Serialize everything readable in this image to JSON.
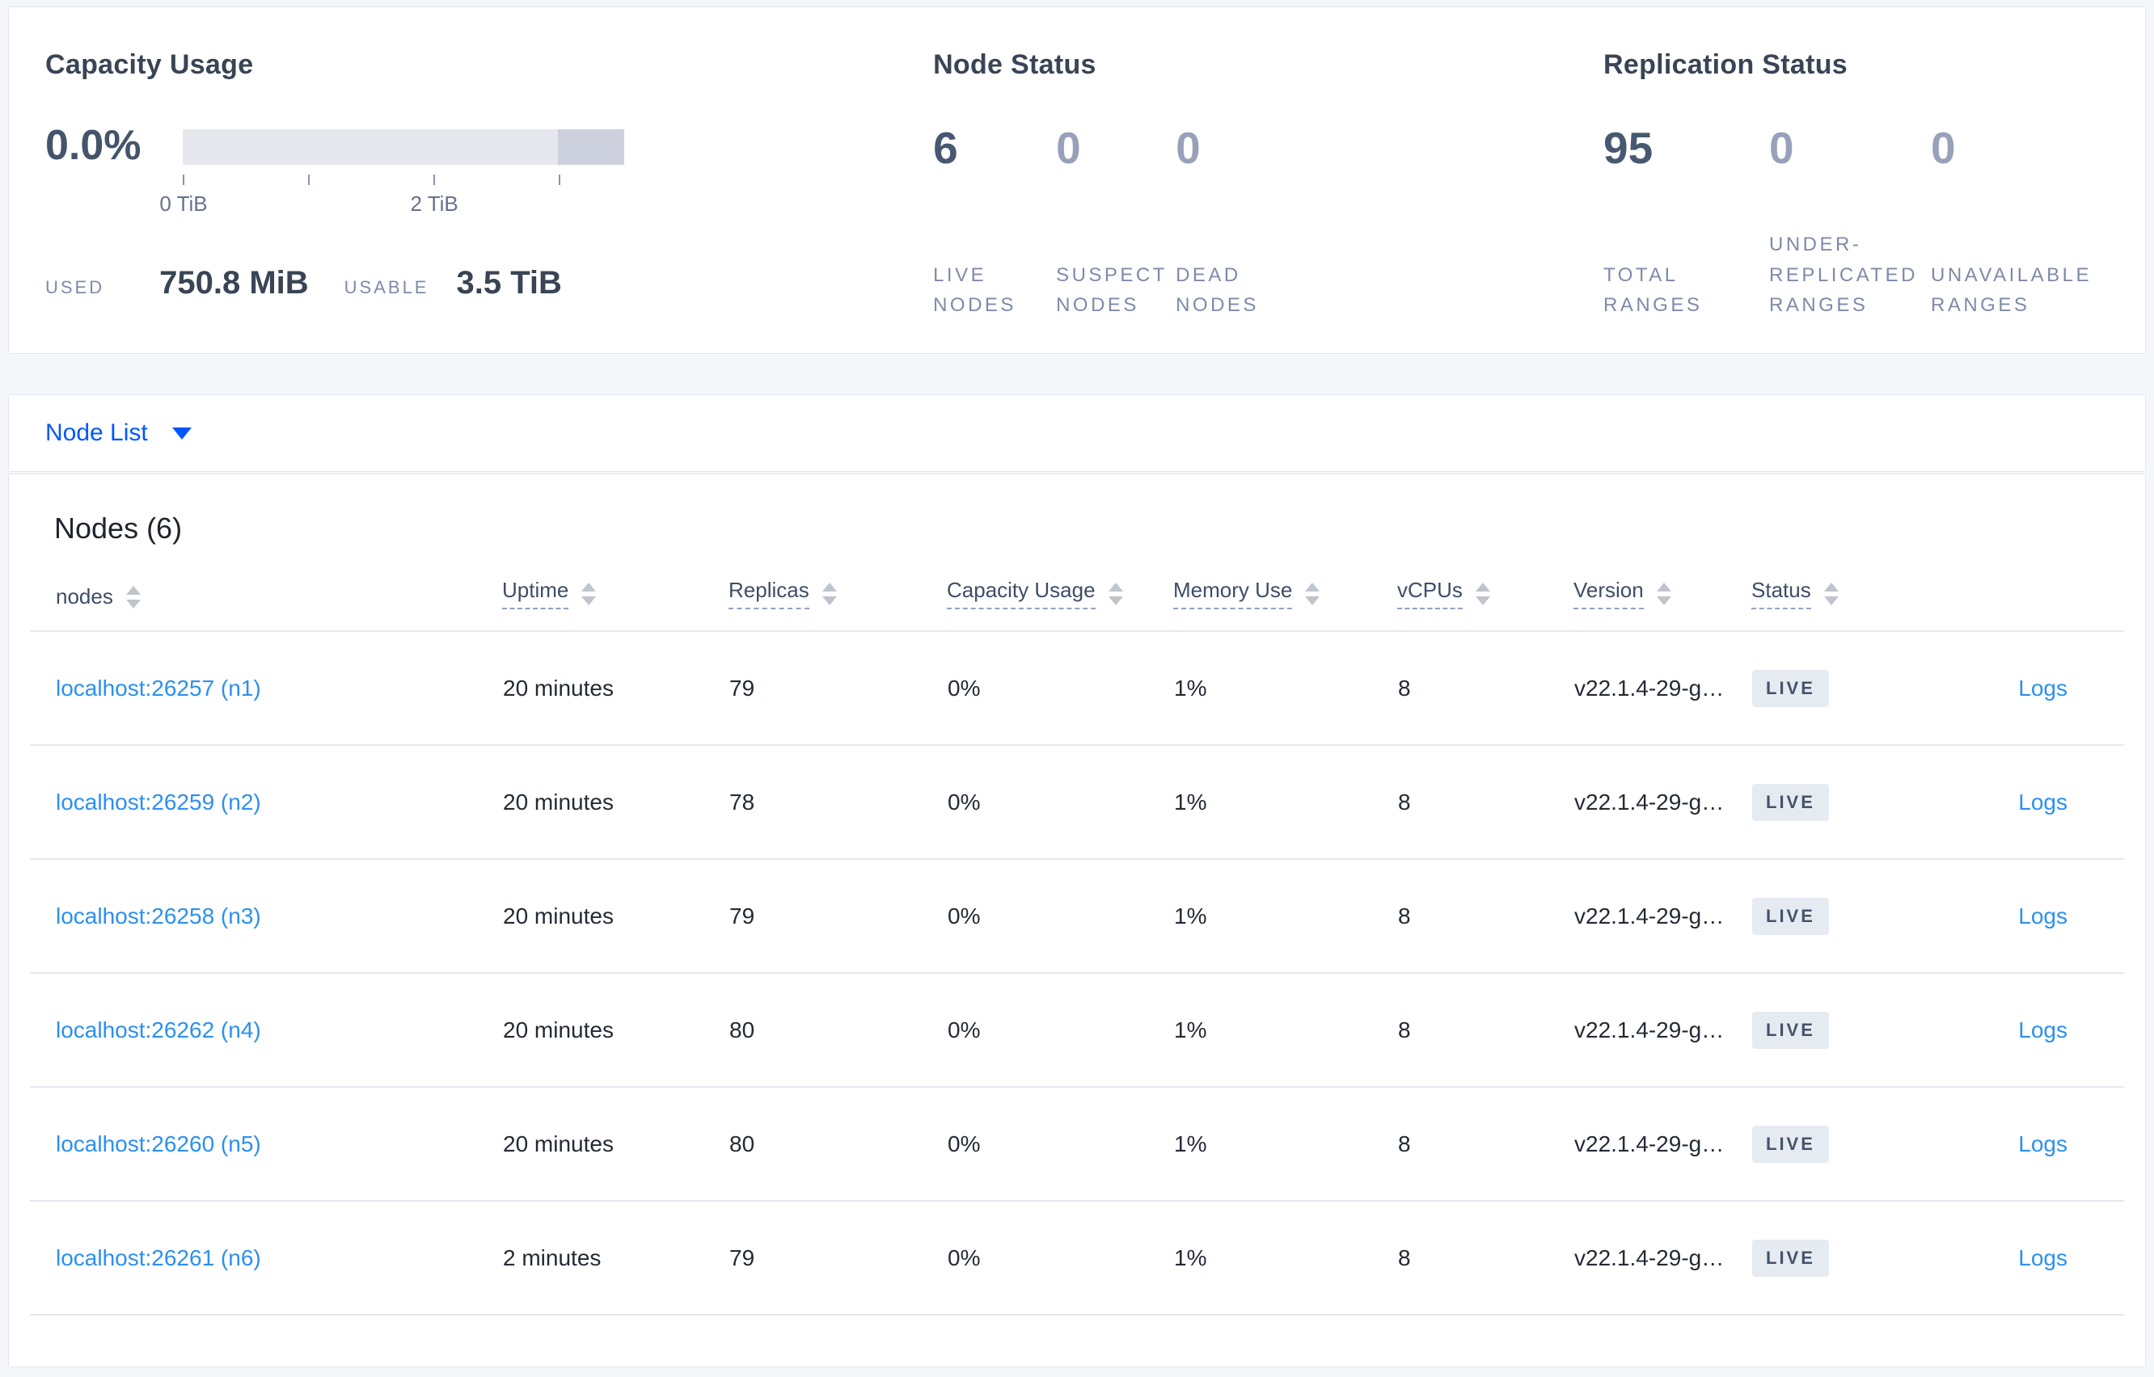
{
  "summary": {
    "capacity": {
      "title": "Capacity Usage",
      "percent": "0.0%",
      "axis_ticks": [
        "0 TiB",
        "2 TiB"
      ],
      "used_label": "USED",
      "used_value": "750.8 MiB",
      "usable_label": "USABLE",
      "usable_value": "3.5 TiB"
    },
    "node_status": {
      "title": "Node Status",
      "stats": [
        {
          "value": "6",
          "label": "LIVE NODES"
        },
        {
          "value": "0",
          "label": "SUSPECT NODES"
        },
        {
          "value": "0",
          "label": "DEAD NODES"
        }
      ]
    },
    "replication": {
      "title": "Replication Status",
      "stats": [
        {
          "value": "95",
          "label": "TOTAL RANGES"
        },
        {
          "value": "0",
          "label": "UNDER-REPLICATED RANGES"
        },
        {
          "value": "0",
          "label": "UNAVAILABLE RANGES"
        }
      ]
    }
  },
  "node_list_dropdown": {
    "label": "Node List",
    "icon": "chevron-down-icon"
  },
  "table": {
    "heading": "Nodes (6)",
    "logs_label": "Logs",
    "columns": [
      {
        "label": "nodes"
      },
      {
        "label": "Uptime"
      },
      {
        "label": "Replicas"
      },
      {
        "label": "Capacity Usage"
      },
      {
        "label": "Memory Use"
      },
      {
        "label": "vCPUs"
      },
      {
        "label": "Version"
      },
      {
        "label": "Status"
      },
      {
        "label": ""
      }
    ],
    "rows": [
      {
        "address": "localhost:26257 (n1)",
        "uptime": "20 minutes",
        "replicas": "79",
        "capacity": "0%",
        "memory": "1%",
        "vcpus": "8",
        "version": "v22.1.4-29-g…",
        "status": "LIVE"
      },
      {
        "address": "localhost:26259 (n2)",
        "uptime": "20 minutes",
        "replicas": "78",
        "capacity": "0%",
        "memory": "1%",
        "vcpus": "8",
        "version": "v22.1.4-29-g…",
        "status": "LIVE"
      },
      {
        "address": "localhost:26258 (n3)",
        "uptime": "20 minutes",
        "replicas": "79",
        "capacity": "0%",
        "memory": "1%",
        "vcpus": "8",
        "version": "v22.1.4-29-g…",
        "status": "LIVE"
      },
      {
        "address": "localhost:26262 (n4)",
        "uptime": "20 minutes",
        "replicas": "80",
        "capacity": "0%",
        "memory": "1%",
        "vcpus": "8",
        "version": "v22.1.4-29-g…",
        "status": "LIVE"
      },
      {
        "address": "localhost:26260 (n5)",
        "uptime": "20 minutes",
        "replicas": "80",
        "capacity": "0%",
        "memory": "1%",
        "vcpus": "8",
        "version": "v22.1.4-29-g…",
        "status": "LIVE"
      },
      {
        "address": "localhost:26261 (n6)",
        "uptime": "2 minutes",
        "replicas": "79",
        "capacity": "0%",
        "memory": "1%",
        "vcpus": "8",
        "version": "v22.1.4-29-g…",
        "status": "LIVE"
      }
    ]
  },
  "colors": {
    "page_background": "#f4f6fa",
    "card_border": "#e2e7ee",
    "accent_blue": "#0356ff",
    "link_blue": "#2b90f0",
    "heading_text": "#394455",
    "stat_number_dark": "#475872",
    "stat_number_muted": "#98a1b9",
    "label_muted": "#7f8aa8",
    "capacity_bar_light": "#e7e8ee",
    "capacity_bar_dark": "#ccd1dd",
    "badge_background": "#e6ebf2"
  }
}
